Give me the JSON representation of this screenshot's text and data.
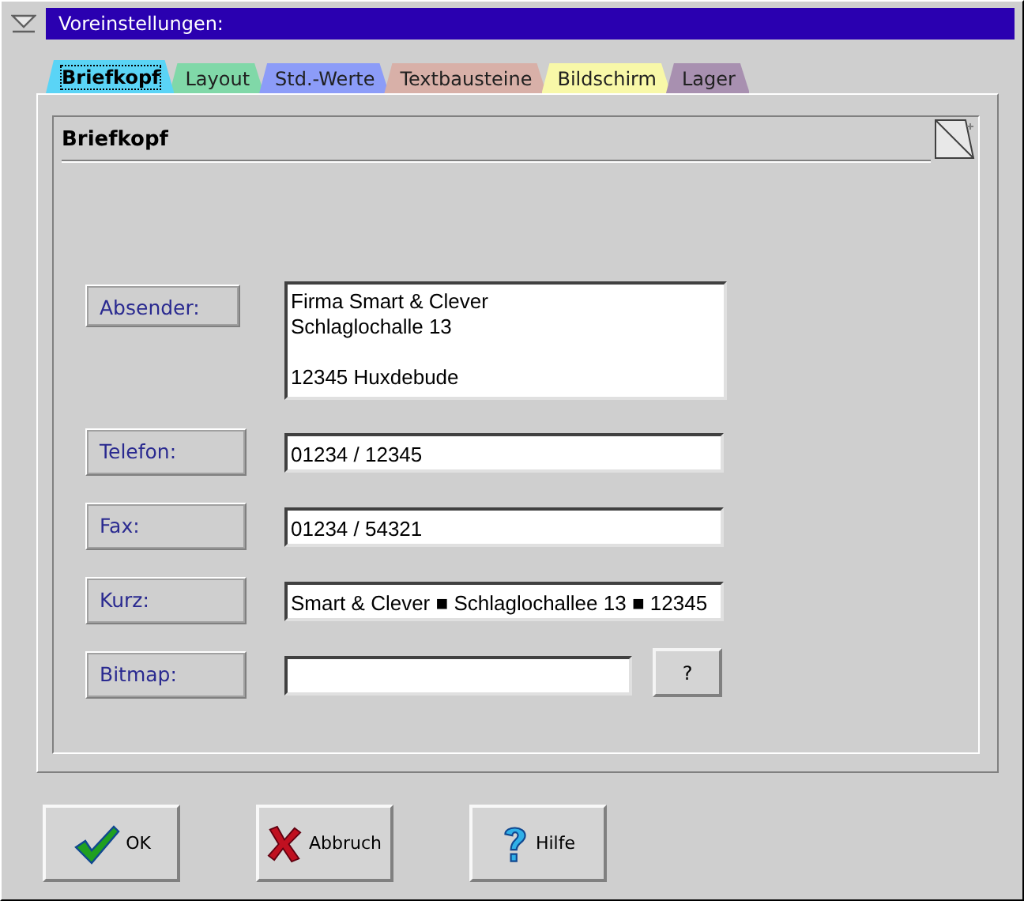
{
  "window": {
    "title": "Voreinstellungen:"
  },
  "tabs": [
    {
      "label": "Briefkopf",
      "color": "#5ad4f6",
      "selected": true
    },
    {
      "label": "Layout",
      "color": "#80d8a8",
      "selected": false
    },
    {
      "label": "Std.-Werte",
      "color": "#8c9cf8",
      "selected": false
    },
    {
      "label": "Textbausteine",
      "color": "#d8b0a8",
      "selected": false
    },
    {
      "label": "Bildschirm",
      "color": "#f8f8a8",
      "selected": false
    },
    {
      "label": "Lager",
      "color": "#a890b0",
      "selected": false
    }
  ],
  "panel": {
    "title": "Briefkopf"
  },
  "fields": [
    {
      "label": "Absender:",
      "kind": "multiline",
      "value": "Firma Smart & Clever\nSchlaglochalle 13\n\n12345 Huxdebude"
    },
    {
      "label": "Telefon:",
      "kind": "single",
      "value": "01234 / 12345"
    },
    {
      "label": "Fax:",
      "kind": "single",
      "value": "01234 / 54321"
    },
    {
      "label": "Kurz:",
      "kind": "single",
      "value": "Smart & Clever ■ Schlaglochallee 13 ■ 12345"
    },
    {
      "label": "Bitmap:",
      "kind": "browse",
      "button": "?"
    }
  ],
  "buttons": [
    {
      "label": "OK",
      "kind": "ok"
    },
    {
      "label": "Abbruch",
      "kind": "cancel"
    },
    {
      "label": "Hilfe",
      "kind": "help"
    }
  ]
}
